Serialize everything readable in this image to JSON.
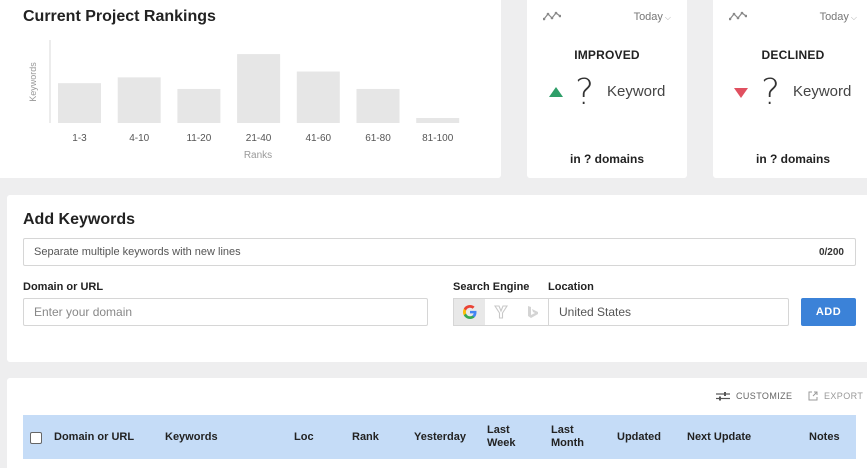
{
  "rankings": {
    "title": "Current Project Rankings",
    "chart_data": {
      "type": "bar",
      "ylabel": "Keywords",
      "xlabel": "Ranks",
      "categories": [
        "1-3",
        "4-10",
        "11-20",
        "21-40",
        "41-60",
        "61-80",
        "81-100"
      ],
      "values": [
        48,
        55,
        41,
        83,
        62,
        41,
        6
      ],
      "ylim": [
        0,
        100
      ],
      "bar_color": "#e6e6e6"
    }
  },
  "improved": {
    "period": "Today",
    "label": "IMPROVED",
    "value": "?",
    "keyword_label": "Keyword",
    "domains_text": "in ? domains",
    "color": "#2e9e68"
  },
  "declined": {
    "period": "Today",
    "label": "DECLINED",
    "value": "?",
    "keyword_label": "Keyword",
    "domains_text": "in ? domains",
    "color": "#e05060"
  },
  "add_keywords": {
    "title": "Add Keywords",
    "keywords_placeholder": "Separate multiple keywords with new lines",
    "count": "0/200",
    "domain_label": "Domain or URL",
    "domain_placeholder": "Enter your domain",
    "search_engine_label": "Search Engine",
    "engines": [
      "google-icon",
      "yahoo-icon",
      "bing-icon"
    ],
    "location_label": "Location",
    "location_value": "United States",
    "add_button": "ADD"
  },
  "table": {
    "customize": "CUSTOMIZE",
    "export": "EXPORT",
    "columns": [
      "Domain or URL",
      "Keywords",
      "Loc",
      "Rank",
      "Yesterday",
      "Last\nWeek",
      "Last\nMonth",
      "Updated",
      "Next Update",
      "Notes"
    ],
    "header_color": "#c5dcf7",
    "accent": "#3b82d8"
  }
}
